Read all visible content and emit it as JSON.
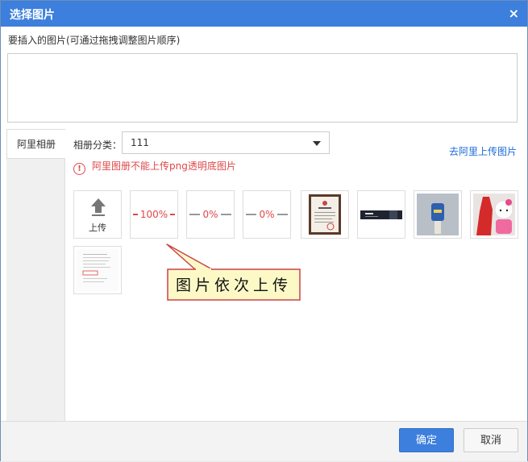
{
  "dialog": {
    "title": "选择图片",
    "close_glyph": "×",
    "hint": "要插入的图片(可通过拖拽调整图片顺序)"
  },
  "sidebar": {
    "tab_label": "阿里相册"
  },
  "category": {
    "label": "相册分类：",
    "selected": "111"
  },
  "upload_link": "去阿里上传图片",
  "warning": {
    "icon": "!",
    "text": "阿里图册不能上传png透明底图片"
  },
  "upload_tile": {
    "icon": "upload-arrow-icon",
    "label": "上传"
  },
  "progress_tiles": [
    {
      "percent_text": "100%",
      "progress": 1.0,
      "color": "#e0474a"
    },
    {
      "percent_text": "0%",
      "progress": 0.0,
      "color": "#e0474a"
    },
    {
      "percent_text": "0%",
      "progress": 0.0,
      "color": "#e0474a"
    }
  ],
  "callout": {
    "text": "图片依次上传"
  },
  "footer": {
    "ok_label": "确定",
    "cancel_label": "取消"
  },
  "colors": {
    "accent": "#3d7fdc",
    "warning": "#e0474a",
    "link": "#1a6ad8",
    "callout_fill": "#fdf9c6",
    "callout_border": "#c8434a"
  }
}
